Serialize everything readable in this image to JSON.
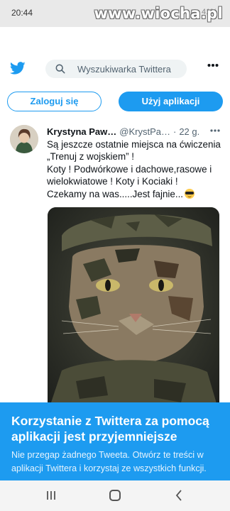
{
  "status": {
    "time": "20:44",
    "right": "41%"
  },
  "watermark": "www.wiocha.pl",
  "header": {
    "search_placeholder": "Wyszukiwarka Twittera"
  },
  "buttons": {
    "login": "Zaloguj się",
    "app": "Użyj aplikacji"
  },
  "tweet": {
    "author": "Krystyna Paw…",
    "handle": "@KrystPa…",
    "separator": "·",
    "time": "22 g.",
    "lines": [
      "Są jeszcze ostatnie miejsca na ćwiczenia",
      "„Trenuj z wojskiem” !",
      "Koty ! Podwórkowe i dachowe,rasowe i",
      "wielokwiatowe ! Koty i Kociaki !",
      "Czekamy na was.....Jest fajnie..."
    ],
    "emoji": "smiling-face-with-sunglasses"
  },
  "banner": {
    "title": "Korzystanie z Twittera za pomocą aplikacji jest przyjemniejsze",
    "text": "Nie przegap żadnego Tweeta. Otwórz te treści w aplikacji Twittera i korzystaj ze wszystkich funkcji."
  },
  "colors": {
    "accent": "#1d9bf0",
    "text": "#0f1419",
    "muted": "#536471"
  }
}
